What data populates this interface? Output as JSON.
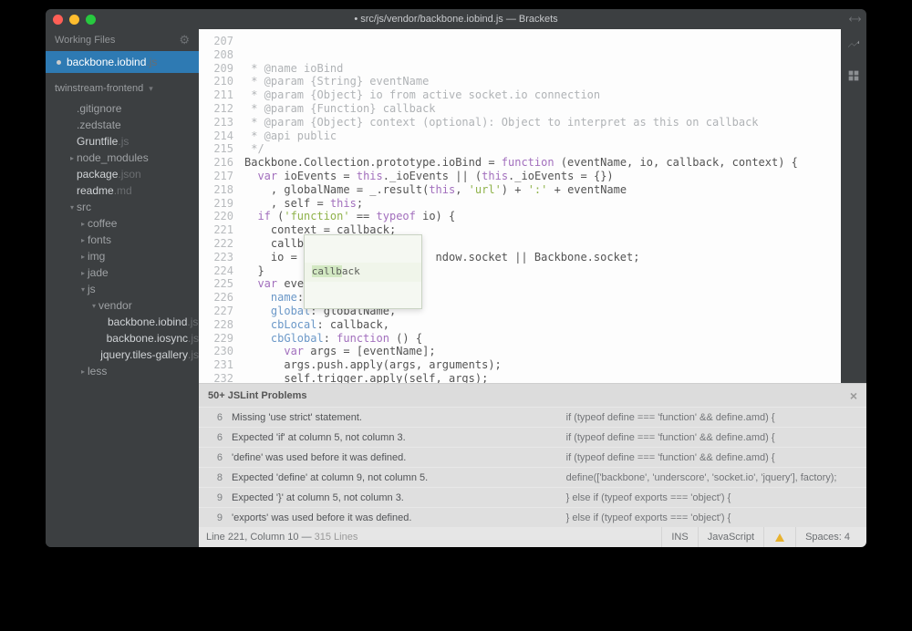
{
  "window": {
    "title": "• src/js/vendor/backbone.iobind.js — Brackets"
  },
  "sidebar": {
    "working_files_label": "Working Files",
    "open_file": {
      "name": "backbone.iobind",
      "ext": ".js",
      "dirty": true
    },
    "project": "twinstream-frontend",
    "tree": [
      {
        "name": ".gitignore",
        "ext": "",
        "depth": 0,
        "arrow": ""
      },
      {
        "name": ".zedstate",
        "ext": "",
        "depth": 0,
        "arrow": ""
      },
      {
        "name": "Gruntfile",
        "ext": ".js",
        "depth": 0,
        "arrow": "",
        "strong": true
      },
      {
        "name": "node_modules",
        "ext": "",
        "depth": 0,
        "arrow": "▸"
      },
      {
        "name": "package",
        "ext": ".json",
        "depth": 0,
        "arrow": "",
        "strong": true
      },
      {
        "name": "readme",
        "ext": ".md",
        "depth": 0,
        "arrow": "",
        "strong": true
      },
      {
        "name": "src",
        "ext": "",
        "depth": 0,
        "arrow": "▾"
      },
      {
        "name": "coffee",
        "ext": "",
        "depth": 1,
        "arrow": "▸"
      },
      {
        "name": "fonts",
        "ext": "",
        "depth": 1,
        "arrow": "▸"
      },
      {
        "name": "img",
        "ext": "",
        "depth": 1,
        "arrow": "▸"
      },
      {
        "name": "jade",
        "ext": "",
        "depth": 1,
        "arrow": "▸"
      },
      {
        "name": "js",
        "ext": "",
        "depth": 1,
        "arrow": "▾"
      },
      {
        "name": "vendor",
        "ext": "",
        "depth": 2,
        "arrow": "▾"
      },
      {
        "name": "backbone.iobind",
        "ext": ".js",
        "depth": 3,
        "arrow": "",
        "strong": true
      },
      {
        "name": "backbone.iosync",
        "ext": ".js",
        "depth": 3,
        "arrow": "",
        "strong": true
      },
      {
        "name": "jquery.tiles-gallery",
        "ext": ".js",
        "depth": 3,
        "arrow": "",
        "strong": true
      },
      {
        "name": "less",
        "ext": "",
        "depth": 1,
        "arrow": "▸"
      }
    ]
  },
  "editor": {
    "first_line": 207,
    "lines": [
      {
        "t": " * @name ioBind",
        "cls": "cm"
      },
      {
        "t": " * @param {String} eventName",
        "cls": "cm"
      },
      {
        "t": " * @param {Object} io from active socket.io connection",
        "cls": "cm"
      },
      {
        "t": " * @param {Function} callback",
        "cls": "cm"
      },
      {
        "t": " * @param {Object} context (optional): Object to interpret as this on callback",
        "cls": "cm"
      },
      {
        "t": " * @api public",
        "cls": "cm"
      },
      {
        "t": " */",
        "cls": "cm"
      },
      {
        "t": "",
        "cls": ""
      },
      {
        "html": "<span class='id'>Backbone.Collection.prototype.ioBind</span> = <span class='kw'>function</span> (<span class='id'>eventName, io, callback, context</span>) {"
      },
      {
        "html": "  <span class='kw'>var</span> <span class='id'>ioEvents</span> = <span class='kw'>this</span>._ioEvents || (<span class='kw'>this</span>._ioEvents = {})"
      },
      {
        "html": "    , <span class='id'>globalName</span> = _.result(<span class='kw'>this</span>, <span class='st'>'url'</span>) + <span class='st'>':'</span> + eventName"
      },
      {
        "html": "    , <span class='id'>self</span> = <span class='kw'>this</span>;"
      },
      {
        "html": "  <span class='kw'>if</span> (<span class='st'>'function'</span> == <span class='kw'>typeof</span> io) {"
      },
      {
        "html": "    context = callback;"
      },
      {
        "html": "    callb"
      },
      {
        "html": "    io =                     ndow.socket || Backbone.socket;"
      },
      {
        "html": "  }"
      },
      {
        "html": "  <span class='kw'>var</span> <span class='id'>event</span> = {"
      },
      {
        "html": "    <span class='hi'>name</span>: eventName,"
      },
      {
        "html": "    <span class='hi'>global</span>: globalName,"
      },
      {
        "html": "    <span class='hi'>cbLocal</span>: callback,"
      },
      {
        "html": "    <span class='hi'>cbGlobal</span>: <span class='kw'>function</span> () {"
      },
      {
        "html": "      <span class='kw'>var</span> args = [eventName];"
      },
      {
        "html": "      args.push.apply(args, <span class='id'>arguments</span>);"
      },
      {
        "html": "      self.trigger.apply(self, args);"
      },
      {
        "html": "    }"
      }
    ],
    "autocomplete": {
      "text": "callback",
      "match_len": 5
    }
  },
  "panel": {
    "title": "50+ JSLint Problems",
    "problems": [
      {
        "line": 6,
        "msg": "Missing 'use strict' statement.",
        "ctx": "if (typeof define === 'function' && define.amd) {"
      },
      {
        "line": 6,
        "msg": "Expected 'if' at column 5, not column 3.",
        "ctx": "if (typeof define === 'function' && define.amd) {"
      },
      {
        "line": 6,
        "msg": "'define' was used before it was defined.",
        "ctx": "if (typeof define === 'function' && define.amd) {"
      },
      {
        "line": 8,
        "msg": "Expected 'define' at column 9, not column 5.",
        "ctx": "define(['backbone', 'underscore', 'socket.io', 'jquery'], factory);"
      },
      {
        "line": 9,
        "msg": "Expected '}' at column 5, not column 3.",
        "ctx": "} else if (typeof exports === 'object') {"
      },
      {
        "line": 9,
        "msg": "'exports' was used before it was defined.",
        "ctx": "} else if (typeof exports === 'object') {"
      }
    ]
  },
  "status": {
    "cursor": "Line 221, Column 10",
    "doc": "315 Lines",
    "ins": "INS",
    "lang": "JavaScript",
    "spaces": "Spaces:  4"
  }
}
